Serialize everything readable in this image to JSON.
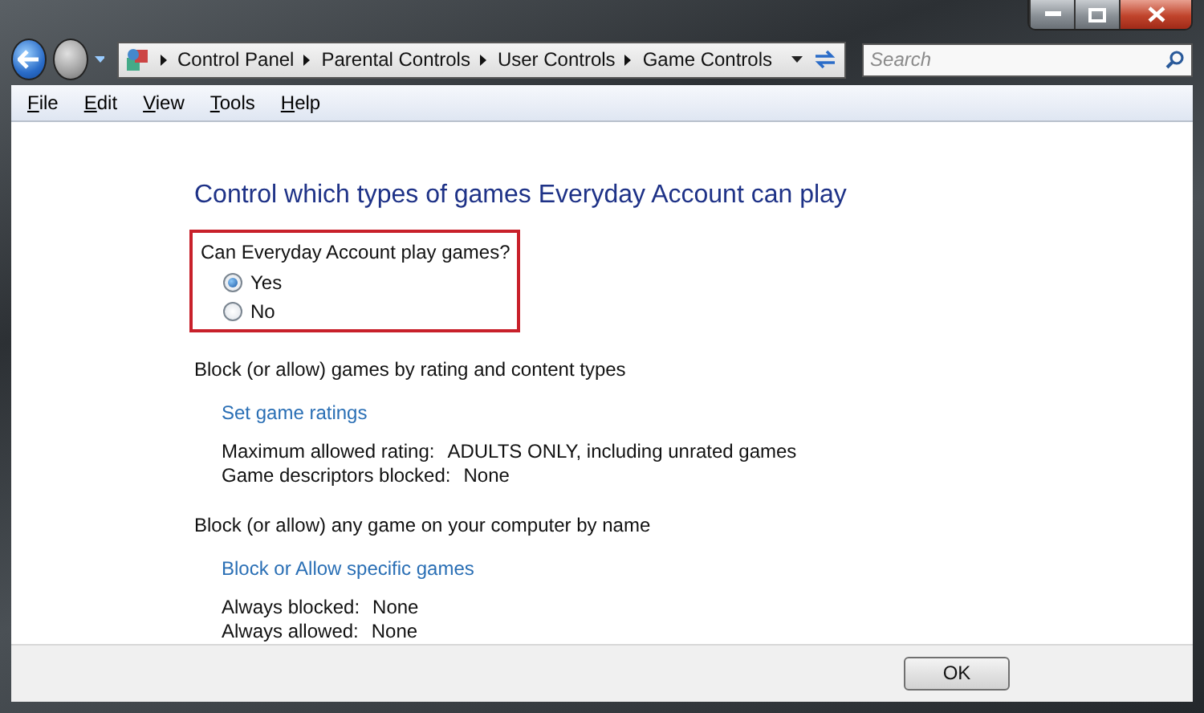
{
  "address_bar": {
    "breadcrumbs": [
      "Control Panel",
      "Parental Controls",
      "User Controls",
      "Game Controls"
    ]
  },
  "search": {
    "placeholder": "Search"
  },
  "menu": [
    "File",
    "Edit",
    "View",
    "Tools",
    "Help"
  ],
  "heading": "Control which types of games Everyday Account can play",
  "question": {
    "label": "Can Everyday Account play games?",
    "options": [
      {
        "label": "Yes",
        "selected": true
      },
      {
        "label": "No",
        "selected": false
      }
    ]
  },
  "sections": [
    {
      "title": "Block (or allow) games by rating and content types",
      "link": "Set game ratings",
      "details": [
        {
          "label": "Maximum allowed rating:",
          "value": "ADULTS ONLY, including unrated games"
        },
        {
          "label": "Game descriptors blocked:",
          "value": "None"
        }
      ]
    },
    {
      "title": "Block (or allow) any game on your computer by name",
      "link": "Block or Allow specific games",
      "details": [
        {
          "label": "Always blocked:",
          "value": "None"
        },
        {
          "label": "Always allowed:",
          "value": "None"
        }
      ]
    }
  ],
  "buttons": [
    "OK"
  ]
}
